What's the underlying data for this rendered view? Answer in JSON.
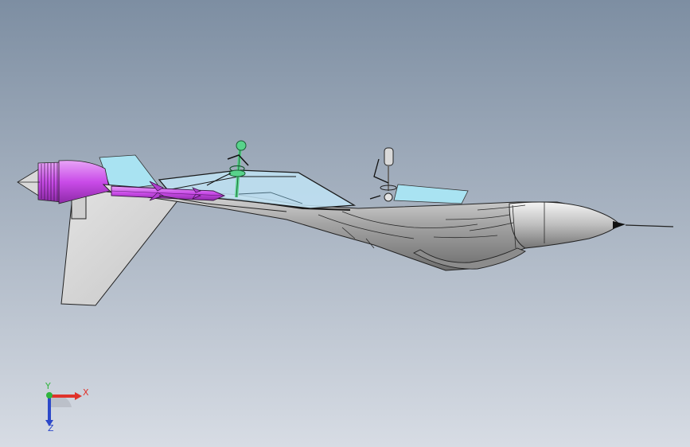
{
  "app": {
    "view": "cad-3d-model-viewport",
    "background": {
      "top": "#7d8ea2",
      "bottom": "#d7dce4"
    }
  },
  "model": {
    "subject": "jet-fighter-aircraft",
    "colors": {
      "fuselage": "#a6a6a6",
      "canopy": "#bfe3f5",
      "missile": "#c64de6",
      "nozzle": "#b23fd1",
      "ejection_rod": "#58d38b",
      "wing": "#d6d6d6",
      "fin": "#a9e3f2",
      "outline": "#111111"
    }
  },
  "triad": {
    "x_label": "X",
    "y_label": "Y",
    "z_label": "Z",
    "x_color": "#e0332b",
    "y_color": "#2fb43d",
    "z_color": "#2d49c9"
  }
}
